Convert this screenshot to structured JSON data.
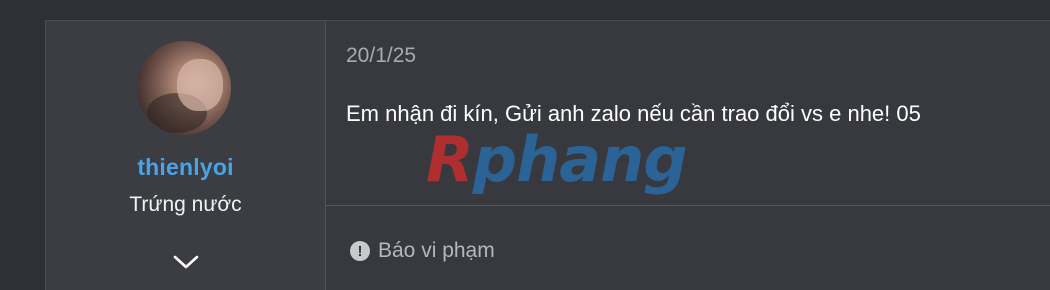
{
  "user": {
    "username": "thienlyoi",
    "title": "Trứng nước"
  },
  "post": {
    "date": "20/1/25",
    "body": "Em nhận đi kín, Gửi anh zalo nếu cần trao đổi vs e nhe! 05",
    "report_label": "Báo vi phạm"
  },
  "watermark": {
    "first": "R",
    "rest": "phang"
  },
  "icons": {
    "expand": "chevron-down-icon",
    "report": "exclamation-circle-icon"
  },
  "colors": {
    "username": "#4aa3e8",
    "background": "#2e3035",
    "panel": "#37393e"
  }
}
